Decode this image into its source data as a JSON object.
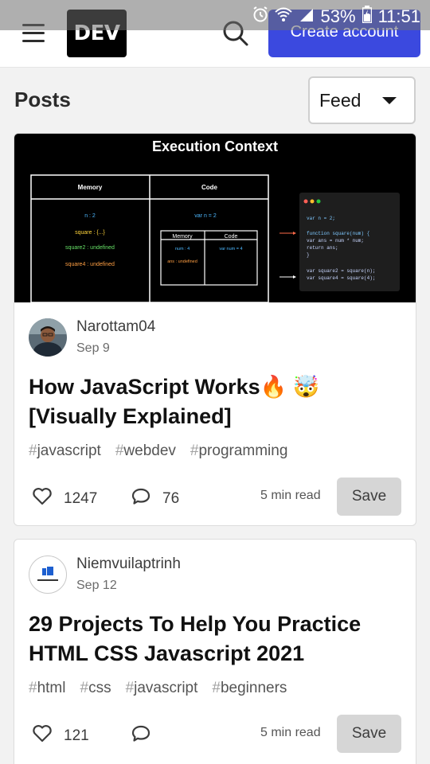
{
  "status_bar": {
    "battery": "53%",
    "time": "11:51"
  },
  "header": {
    "logo_text": "DEV",
    "create_account_label": "Create account",
    "brand_color": "#3b49df"
  },
  "feed": {
    "title": "Posts",
    "select_value": "Feed"
  },
  "posts": [
    {
      "cover": {
        "title": "Execution Context",
        "memory_header": "Memory",
        "code_header": "Code",
        "memory_items": [
          "n : 2",
          "square : {...}",
          "square2 : undefined",
          "square4 : undefined"
        ],
        "code_item": "var n = 2",
        "inner_memory_header": "Memory",
        "inner_code_header": "Code",
        "inner_memory_items": [
          "num : 4",
          "ans : undefined"
        ],
        "inner_code_item": "var num = 4",
        "code_lines": [
          "var n = 2;",
          "function square(num) {",
          "  var ans = num * num;",
          "  return ans;",
          "}",
          "var square2 = square(n);",
          "var square4 = square(4);"
        ]
      },
      "author": "Narottam04",
      "date": "Sep 9",
      "title": "How JavaScript Works🔥 🤯 [Visually Explained]",
      "tags": [
        {
          "hash": "#",
          "name": "javascript"
        },
        {
          "hash": "#",
          "name": "webdev"
        },
        {
          "hash": "#",
          "name": "programming"
        }
      ],
      "reactions": "1247",
      "comments": "76",
      "read_time": "5 min read",
      "save_label": "Save"
    },
    {
      "author": "Niemvuilaptrinh",
      "date": "Sep 12",
      "title": "29 Projects To Help You Practice HTML CSS Javascript 2021",
      "tags": [
        {
          "hash": "#",
          "name": "html"
        },
        {
          "hash": "#",
          "name": "css"
        },
        {
          "hash": "#",
          "name": "javascript"
        },
        {
          "hash": "#",
          "name": "beginners"
        }
      ],
      "reactions": "121",
      "read_time": "5 min read",
      "save_label": "Save"
    }
  ]
}
